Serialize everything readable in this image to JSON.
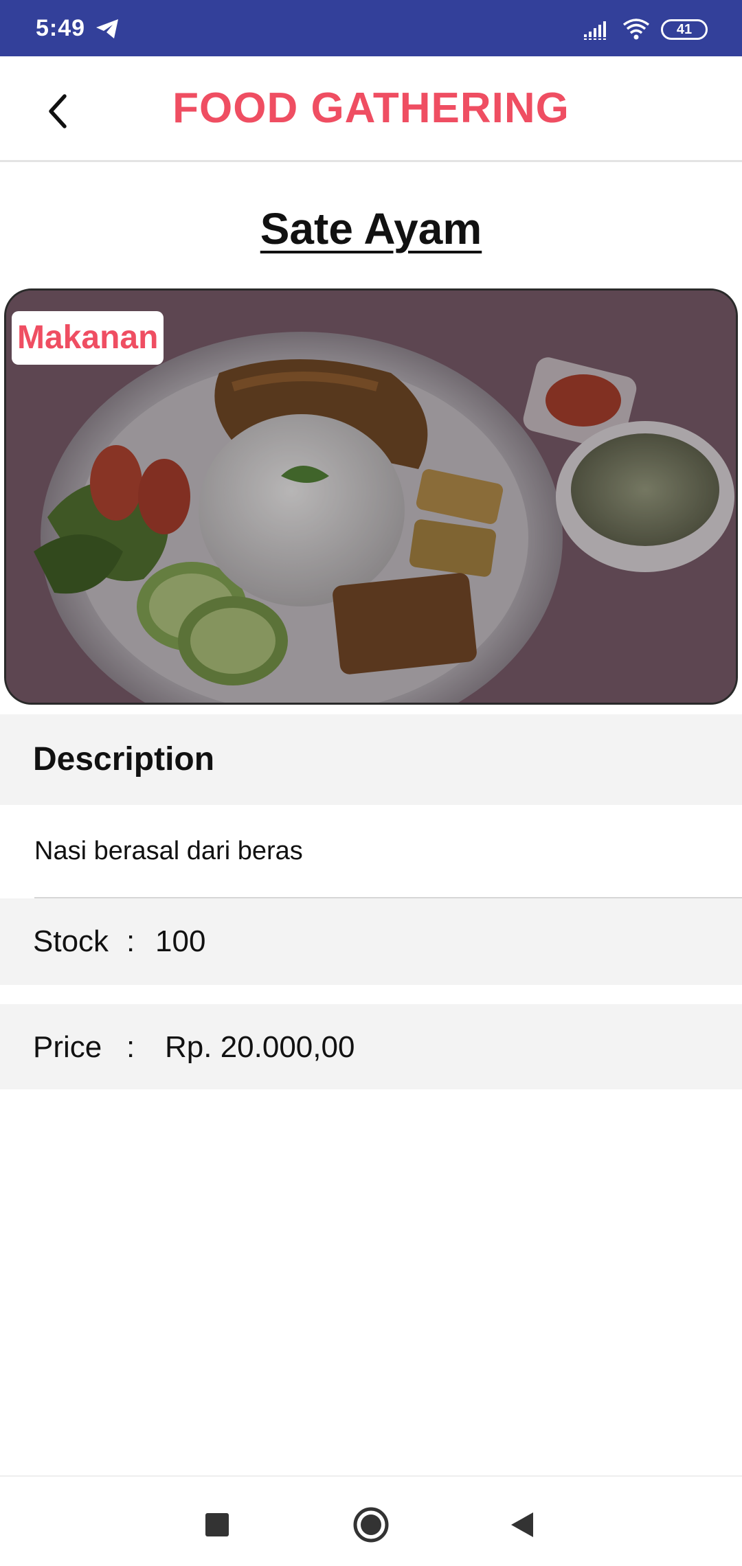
{
  "status_bar": {
    "time": "5:49",
    "battery": "41",
    "icons": [
      "telegram-icon",
      "signal-icon",
      "wifi-icon",
      "battery-icon"
    ]
  },
  "app_bar": {
    "title": "FOOD GATHERING",
    "back_icon": "chevron-left-icon"
  },
  "product": {
    "name": "Sate Ayam",
    "category": "Makanan",
    "image_alt": "food plate photo"
  },
  "description": {
    "header": "Description",
    "text": "Nasi berasal dari beras"
  },
  "stock": {
    "label": "Stock",
    "separator": ":",
    "value": "100"
  },
  "price": {
    "label": "Price",
    "separator": ":",
    "value": "Rp. 20.000,00"
  },
  "nav_bar": {
    "icons": [
      "recents-square-icon",
      "home-circle-icon",
      "back-triangle-icon"
    ]
  },
  "colors": {
    "status_bar": "#33409a",
    "accent": "#ef4e62",
    "row_background": "#f3f3f3"
  }
}
